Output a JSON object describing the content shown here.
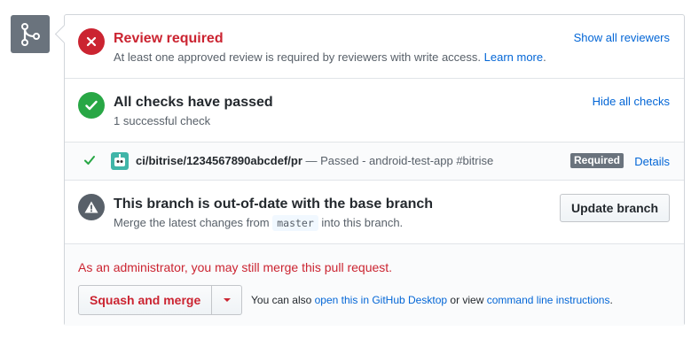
{
  "review": {
    "title": "Review required",
    "description": "At least one approved review is required by reviewers with write access.",
    "learn_more": "Learn more",
    "show_reviewers": "Show all reviewers"
  },
  "checks": {
    "title": "All checks have passed",
    "summary": "1 successful check",
    "hide_checks": "Hide all checks",
    "items": [
      {
        "name": "ci/bitrise/1234567890abcdef/pr",
        "description": "— Passed - android-test-app #bitrise",
        "badge": "Required",
        "details": "Details"
      }
    ]
  },
  "branch": {
    "title": "This branch is out-of-date with the base branch",
    "desc_prefix": "Merge the latest changes from",
    "base_branch": "master",
    "desc_suffix": "into this branch.",
    "update_button": "Update branch"
  },
  "merge": {
    "admin_note": "As an administrator, you may still merge this pull request.",
    "squash_button": "Squash and merge",
    "also_prefix": "You can also",
    "desktop_link": "open this in GitHub Desktop",
    "or_view": "or view",
    "cli_link": "command line instructions",
    "period": "."
  },
  "colors": {
    "danger": "#cb2431",
    "success": "#28a745",
    "link": "#0366d6",
    "muted": "#586069"
  },
  "icons": {
    "merge": "git-merge-icon",
    "review": "x-icon",
    "checks": "check-icon",
    "branch": "alert-icon"
  }
}
